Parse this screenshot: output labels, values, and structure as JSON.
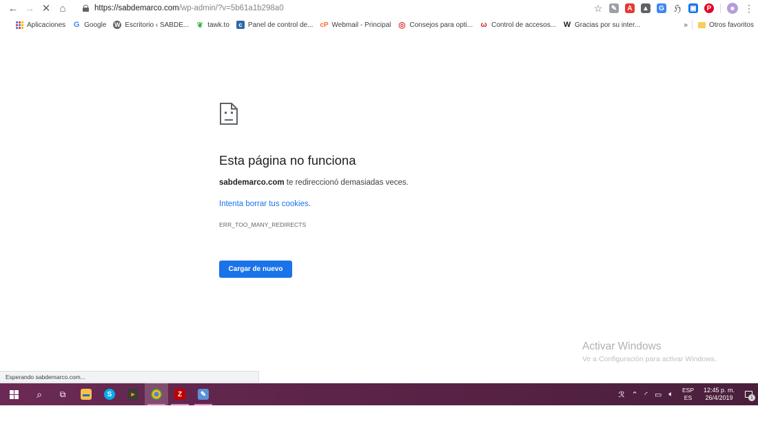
{
  "browser": {
    "url_host": "https://sabdemarco.com",
    "url_path": "/wp-admin/?v=5b61a1b298a0",
    "bookmarks": [
      {
        "label": "Aplicaciones",
        "icon": "apps-icon"
      },
      {
        "label": "Google",
        "icon": "google-icon",
        "icon_color": "#4285f4"
      },
      {
        "label": "Escritorio ‹ SABDE...",
        "icon": "wordpress-icon",
        "icon_color": "#5f6368"
      },
      {
        "label": "tawk.to",
        "icon": "tawk-icon",
        "icon_color": "#39b54a"
      },
      {
        "label": "Panel de control de...",
        "icon": "cpanel-icon",
        "icon_color": "#2e6ba8"
      },
      {
        "label": "Webmail - Principal",
        "icon": "webmail-icon",
        "icon_color": "#ff6c2c"
      },
      {
        "label": "Consejos para opti...",
        "icon": "target-icon",
        "icon_color": "#e53935"
      },
      {
        "label": "Control de accesos...",
        "icon": "w-red-icon",
        "icon_color": "#d32f2f"
      },
      {
        "label": "Gracias por su inter...",
        "icon": "w-black-icon",
        "icon_color": "#202124"
      }
    ],
    "more_bookmarks": "»",
    "other_favorites": "Otros favoritos",
    "status_text": "Esperando sabdemarco.com..."
  },
  "error": {
    "title": "Esta página no funciona",
    "domain": "sabdemarco.com",
    "message_rest": " te redireccionó demasiadas veces.",
    "link": "Intenta borrar tus cookies.",
    "code": "ERR_TOO_MANY_REDIRECTS",
    "reload_label": "Cargar de nuevo"
  },
  "watermark": {
    "title": "Activar Windows",
    "subtitle": "Ve a Configuración para activar Windows."
  },
  "taskbar": {
    "lang_top": "ESP",
    "lang_bottom": "ES",
    "time": "12:45 p. m.",
    "date": "26/4/2019",
    "notification_count": "1",
    "accent": "#6b2a55"
  }
}
